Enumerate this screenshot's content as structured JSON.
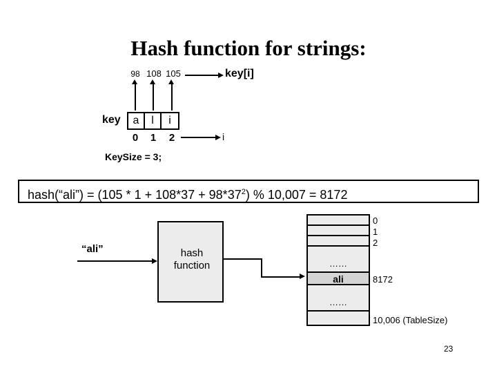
{
  "slide": {
    "title": "Hash function for strings:",
    "page_number": "23",
    "background_color": "#ffffff"
  },
  "key_diagram": {
    "key_label": "key",
    "keyi_label": "key[i]",
    "index_var_label": "i",
    "keysize_statement": "KeySize = 3;",
    "cells": [
      {
        "char": "a",
        "index": "0",
        "ascii": "98"
      },
      {
        "char": "l",
        "index": "1",
        "ascii": "108"
      },
      {
        "char": "i",
        "index": "2",
        "ascii": "105"
      }
    ]
  },
  "formula": {
    "prefix": "hash(“ali”) = (105 * 1  +  108*37  +  98*37",
    "exponent": "2",
    "suffix": ") % 10,007 = 8172",
    "full_text": "hash(“ali”) = (105 * 1  +  108*37  +  98*37²) % 10,007 = 8172"
  },
  "flow": {
    "input_label": "“ali”",
    "hash_box_line1": "hash",
    "hash_box_line2": "function",
    "hash_box_fill": "#ececec"
  },
  "hash_table": {
    "fill_color": "#ececec",
    "highlight_color": "#d4d4d4",
    "rows": [
      {
        "content": "",
        "label": "0"
      },
      {
        "content": "",
        "label": "1"
      },
      {
        "content": "",
        "label": "2"
      },
      {
        "content": "……",
        "label": ""
      },
      {
        "content": "ali",
        "label": "8172"
      },
      {
        "content": "……",
        "label": ""
      },
      {
        "content": "",
        "label": "10,006 (TableSize)"
      }
    ]
  }
}
